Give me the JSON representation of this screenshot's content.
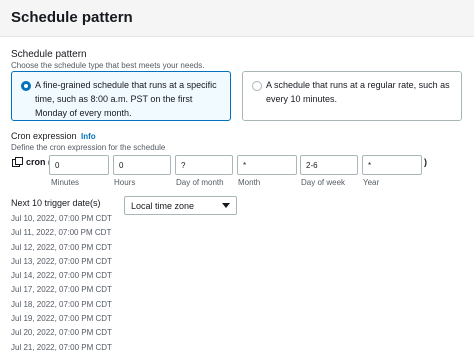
{
  "header": {
    "title": "Schedule pattern"
  },
  "pattern": {
    "label": "Schedule pattern",
    "description": "Choose the schedule type that best meets your needs.",
    "options": [
      {
        "text": "A fine-grained schedule that runs at a specific time, such as 8:00 a.m. PST on the first Monday of every month.",
        "selected": true
      },
      {
        "text": "A schedule that runs at a regular rate, such as every 10 minutes.",
        "selected": false
      }
    ]
  },
  "cron": {
    "label": "Cron expression",
    "info": "Info",
    "description": "Define the cron expression for the schedule",
    "prefix": "cron (",
    "suffix": ")",
    "fields": [
      {
        "value": "0",
        "label": "Minutes"
      },
      {
        "value": "0",
        "label": "Hours"
      },
      {
        "value": "?",
        "label": "Day of month"
      },
      {
        "value": "*",
        "label": "Month"
      },
      {
        "value": "2-6",
        "label": "Day of week"
      },
      {
        "value": "*",
        "label": "Year"
      }
    ]
  },
  "trigger": {
    "label": "Next 10 trigger date(s)",
    "timezone": "Local time zone",
    "dates": [
      "Jul 10, 2022, 07:00 PM CDT",
      "Jul 11, 2022, 07:00 PM CDT",
      "Jul 12, 2022, 07:00 PM CDT",
      "Jul 13, 2022, 07:00 PM CDT",
      "Jul 14, 2022, 07:00 PM CDT",
      "Jul 17, 2022, 07:00 PM CDT",
      "Jul 18, 2022, 07:00 PM CDT",
      "Jul 19, 2022, 07:00 PM CDT",
      "Jul 20, 2022, 07:00 PM CDT",
      "Jul 21, 2022, 07:00 PM CDT"
    ]
  }
}
